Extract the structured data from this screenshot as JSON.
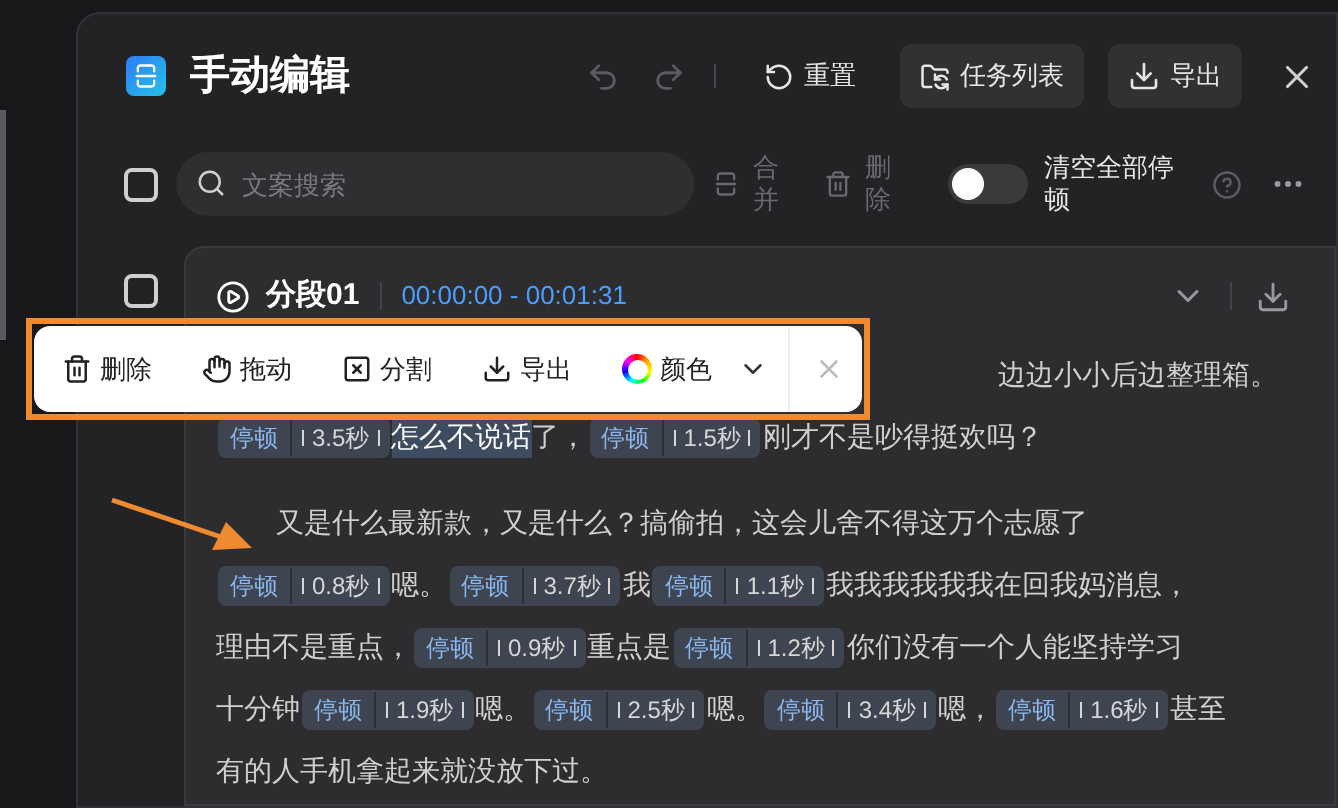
{
  "window": {
    "title": "手动编辑",
    "actions": [
      {
        "kind": "plain",
        "label": "重置"
      },
      {
        "kind": "filled",
        "label": "任务列表"
      },
      {
        "kind": "filled",
        "label": "导出"
      }
    ]
  },
  "toolbar": {
    "select_all_checked": false,
    "search": {
      "placeholder": "文案搜索"
    },
    "merge": "合并",
    "delete": "删除",
    "clear_pauses": {
      "label": "清空全部停顿",
      "on": false
    }
  },
  "segment": {
    "checked": false,
    "title": "分段01",
    "time": "00:00:00 - 00:01:31",
    "paragraphs": [
      {
        "lines": [
          [
            {
              "kind": "text",
              "text": "边边小小后边整理箱。",
              "selected": false
            }
          ],
          [
            {
              "kind": "pause",
              "label": "停顿",
              "duration": "3.5秒"
            },
            {
              "kind": "text",
              "text": "怎么不说话",
              "selected": true
            },
            {
              "kind": "text",
              "text": "了，",
              "selected": false
            },
            {
              "kind": "pause",
              "label": "停顿",
              "duration": "1.5秒"
            },
            {
              "kind": "text",
              "text": "刚才不是吵得挺欢吗？",
              "selected": false
            }
          ]
        ]
      },
      {
        "lines": [
          [
            {
              "kind": "text",
              "text": "又是什么最新款，又是什么？搞偷拍，这会儿舍不得这万个志愿了",
              "selected": false
            }
          ],
          [
            {
              "kind": "pause",
              "label": "停顿",
              "duration": "0.8秒"
            },
            {
              "kind": "text",
              "text": "嗯。",
              "selected": false
            },
            {
              "kind": "pause",
              "label": "停顿",
              "duration": "3.7秒"
            },
            {
              "kind": "text",
              "text": "我",
              "selected": false
            },
            {
              "kind": "pause",
              "label": "停顿",
              "duration": "1.1秒"
            },
            {
              "kind": "text",
              "text": "我我我我我我在回我妈消息，",
              "selected": false
            }
          ],
          [
            {
              "kind": "text",
              "text": "理由不是重点，",
              "selected": false
            },
            {
              "kind": "pause",
              "label": "停顿",
              "duration": "0.9秒"
            },
            {
              "kind": "text",
              "text": "重点是",
              "selected": false
            },
            {
              "kind": "pause",
              "label": "停顿",
              "duration": "1.2秒"
            },
            {
              "kind": "text",
              "text": "你们没有一个人能坚持学习",
              "selected": false
            }
          ],
          [
            {
              "kind": "text",
              "text": "十分钟",
              "selected": false
            },
            {
              "kind": "pause",
              "label": "停顿",
              "duration": "1.9秒"
            },
            {
              "kind": "text",
              "text": "嗯。",
              "selected": false
            },
            {
              "kind": "pause",
              "label": "停顿",
              "duration": "2.5秒"
            },
            {
              "kind": "text",
              "text": "嗯。",
              "selected": false
            },
            {
              "kind": "pause",
              "label": "停顿",
              "duration": "3.4秒"
            },
            {
              "kind": "text",
              "text": "嗯，",
              "selected": false
            },
            {
              "kind": "pause",
              "label": "停顿",
              "duration": "1.6秒"
            },
            {
              "kind": "text",
              "text": "甚至",
              "selected": false
            }
          ],
          [
            {
              "kind": "text",
              "text": "有的人手机拿起来就没放下过。",
              "selected": false
            }
          ]
        ]
      }
    ]
  },
  "floating_menu": {
    "items": [
      {
        "kind": "delete",
        "label": "删除"
      },
      {
        "kind": "drag",
        "label": "拖动"
      },
      {
        "kind": "split",
        "label": "分割"
      },
      {
        "kind": "export",
        "label": "导出"
      },
      {
        "kind": "color",
        "label": "颜色"
      }
    ]
  }
}
